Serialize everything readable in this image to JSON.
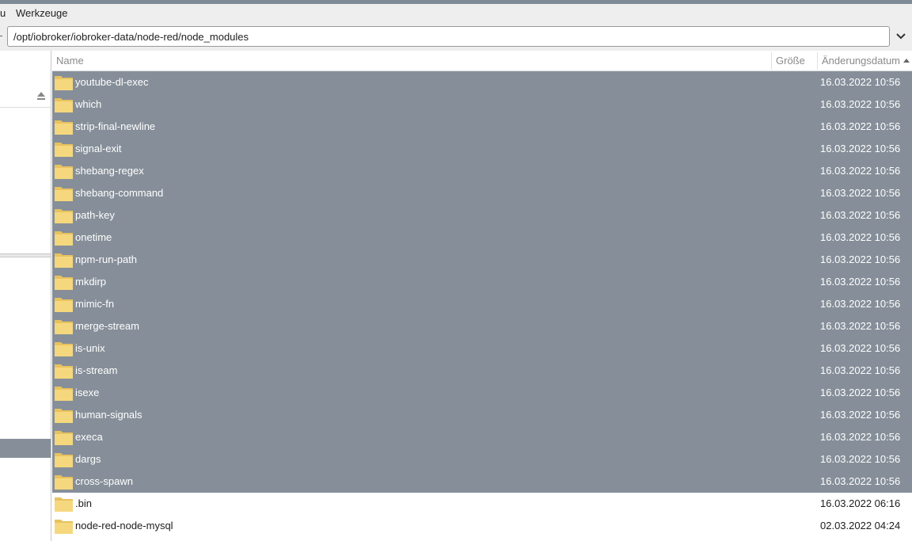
{
  "menubar": {
    "items": [
      "u",
      "Werkzeuge"
    ]
  },
  "pathbar": {
    "path": "/opt/iobroker/iobroker-data/node-red/node_modules"
  },
  "columns": {
    "name": "Name",
    "size": "Größe",
    "modified": "Änderungsdatum"
  },
  "colors": {
    "selection": "#868f99",
    "folder": "#f5d87e",
    "top_strip": "#7e8a96"
  },
  "files": [
    {
      "name": "youtube-dl-exec",
      "modified": "16.03.2022 10:56",
      "selected": true
    },
    {
      "name": "which",
      "modified": "16.03.2022 10:56",
      "selected": true
    },
    {
      "name": "strip-final-newline",
      "modified": "16.03.2022 10:56",
      "selected": true
    },
    {
      "name": "signal-exit",
      "modified": "16.03.2022 10:56",
      "selected": true
    },
    {
      "name": "shebang-regex",
      "modified": "16.03.2022 10:56",
      "selected": true
    },
    {
      "name": "shebang-command",
      "modified": "16.03.2022 10:56",
      "selected": true
    },
    {
      "name": "path-key",
      "modified": "16.03.2022 10:56",
      "selected": true
    },
    {
      "name": "onetime",
      "modified": "16.03.2022 10:56",
      "selected": true
    },
    {
      "name": "npm-run-path",
      "modified": "16.03.2022 10:56",
      "selected": true
    },
    {
      "name": "mkdirp",
      "modified": "16.03.2022 10:56",
      "selected": true
    },
    {
      "name": "mimic-fn",
      "modified": "16.03.2022 10:56",
      "selected": true
    },
    {
      "name": "merge-stream",
      "modified": "16.03.2022 10:56",
      "selected": true
    },
    {
      "name": "is-unix",
      "modified": "16.03.2022 10:56",
      "selected": true
    },
    {
      "name": "is-stream",
      "modified": "16.03.2022 10:56",
      "selected": true
    },
    {
      "name": "isexe",
      "modified": "16.03.2022 10:56",
      "selected": true
    },
    {
      "name": "human-signals",
      "modified": "16.03.2022 10:56",
      "selected": true
    },
    {
      "name": "execa",
      "modified": "16.03.2022 10:56",
      "selected": true
    },
    {
      "name": "dargs",
      "modified": "16.03.2022 10:56",
      "selected": true
    },
    {
      "name": "cross-spawn",
      "modified": "16.03.2022 10:56",
      "selected": true
    },
    {
      "name": ".bin",
      "modified": "16.03.2022 06:16",
      "selected": false
    },
    {
      "name": "node-red-node-mysql",
      "modified": "02.03.2022 04:24",
      "selected": false
    }
  ]
}
